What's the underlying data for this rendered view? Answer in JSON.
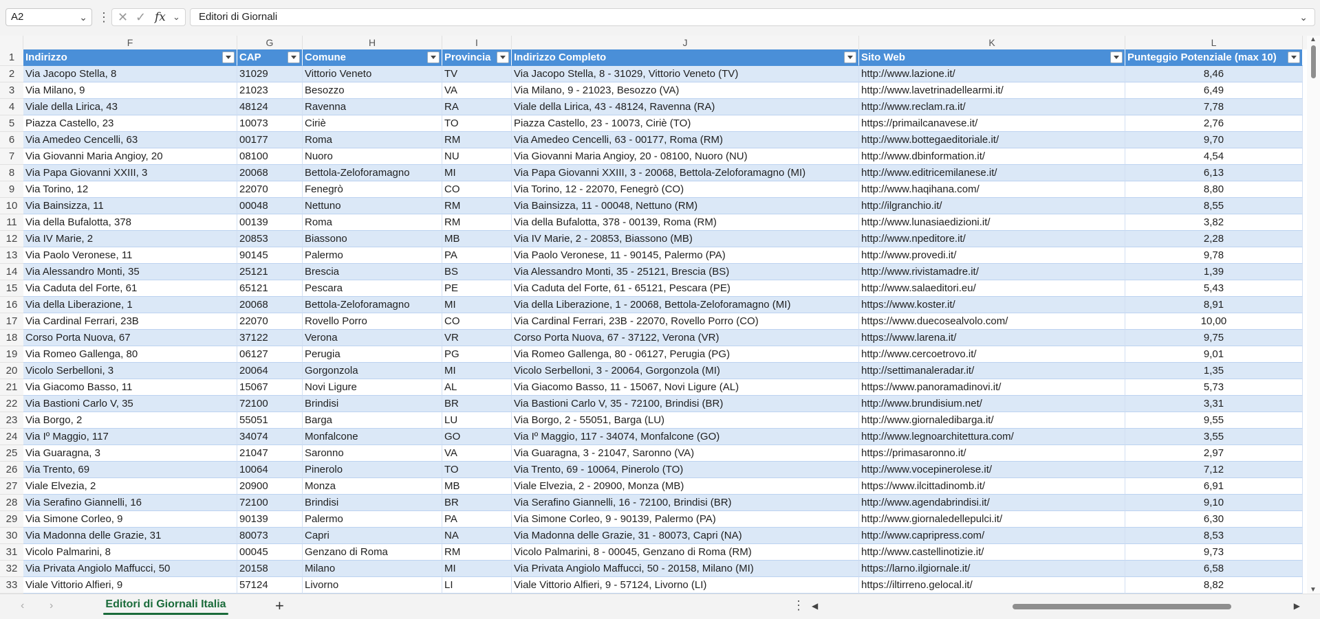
{
  "formula_bar": {
    "cell_ref": "A2",
    "formula_value": "Editori di Giornali",
    "fx_label": "fx",
    "cancel_icon": "close-icon",
    "enter_icon": "check-icon"
  },
  "columns": [
    "F",
    "G",
    "H",
    "I",
    "J",
    "K",
    "L"
  ],
  "table": {
    "headers": [
      "Indirizzo",
      "CAP",
      "Comune",
      "Provincia",
      "Indirizzo Completo",
      "Sito Web",
      "Punteggio Potenziale (max 10)"
    ],
    "rows": [
      [
        "2",
        "Via Jacopo Stella, 8",
        "31029",
        "Vittorio Veneto",
        "TV",
        "Via Jacopo Stella, 8 - 31029, Vittorio Veneto (TV)",
        "http://www.lazione.it/",
        "8,46"
      ],
      [
        "3",
        "Via Milano, 9",
        "21023",
        "Besozzo",
        "VA",
        "Via Milano, 9 - 21023, Besozzo (VA)",
        "http://www.lavetrinadellearmi.it/",
        "6,49"
      ],
      [
        "4",
        "Viale della Lirica, 43",
        "48124",
        "Ravenna",
        "RA",
        "Viale della Lirica, 43 - 48124, Ravenna (RA)",
        "http://www.reclam.ra.it/",
        "7,78"
      ],
      [
        "5",
        "Piazza Castello, 23",
        "10073",
        "Ciriè",
        "TO",
        "Piazza Castello, 23 - 10073, Ciriè (TO)",
        "https://primailcanavese.it/",
        "2,76"
      ],
      [
        "6",
        "Via Amedeo Cencelli, 63",
        "00177",
        "Roma",
        "RM",
        "Via Amedeo Cencelli, 63 - 00177, Roma (RM)",
        "http://www.bottegaeditoriale.it/",
        "9,70"
      ],
      [
        "7",
        "Via Giovanni Maria Angioy, 20",
        "08100",
        "Nuoro",
        "NU",
        "Via Giovanni Maria Angioy, 20 - 08100, Nuoro (NU)",
        "http://www.dbinformation.it/",
        "4,54"
      ],
      [
        "8",
        "Via Papa Giovanni XXIII, 3",
        "20068",
        "Bettola-Zeloforamagno",
        "MI",
        "Via Papa Giovanni XXIII, 3 - 20068, Bettola-Zeloforamagno (MI)",
        "http://www.editricemilanese.it/",
        "6,13"
      ],
      [
        "9",
        "Via Torino, 12",
        "22070",
        "Fenegrò",
        "CO",
        "Via Torino, 12 - 22070, Fenegrò (CO)",
        "http://www.haqihana.com/",
        "8,80"
      ],
      [
        "10",
        "Via Bainsizza, 11",
        "00048",
        "Nettuno",
        "RM",
        "Via Bainsizza, 11 - 00048, Nettuno (RM)",
        "http://ilgranchio.it/",
        "8,55"
      ],
      [
        "11",
        "Via della Bufalotta, 378",
        "00139",
        "Roma",
        "RM",
        "Via della Bufalotta, 378 - 00139, Roma (RM)",
        "http://www.lunasiaedizioni.it/",
        "3,82"
      ],
      [
        "12",
        "Via IV Marie, 2",
        "20853",
        "Biassono",
        "MB",
        "Via IV Marie, 2 - 20853, Biassono (MB)",
        "http://www.npeditore.it/",
        "2,28"
      ],
      [
        "13",
        "Via Paolo Veronese, 11",
        "90145",
        "Palermo",
        "PA",
        "Via Paolo Veronese, 11 - 90145, Palermo (PA)",
        "http://www.provedi.it/",
        "9,78"
      ],
      [
        "14",
        "Via Alessandro Monti, 35",
        "25121",
        "Brescia",
        "BS",
        "Via Alessandro Monti, 35 - 25121, Brescia (BS)",
        "http://www.rivistamadre.it/",
        "1,39"
      ],
      [
        "15",
        "Via Caduta del Forte, 61",
        "65121",
        "Pescara",
        "PE",
        "Via Caduta del Forte, 61 - 65121, Pescara (PE)",
        "http://www.salaeditori.eu/",
        "5,43"
      ],
      [
        "16",
        "Via della Liberazione, 1",
        "20068",
        "Bettola-Zeloforamagno",
        "MI",
        "Via della Liberazione, 1 - 20068, Bettola-Zeloforamagno (MI)",
        "https://www.koster.it/",
        "8,91"
      ],
      [
        "17",
        "Via Cardinal Ferrari, 23B",
        "22070",
        "Rovello Porro",
        "CO",
        "Via Cardinal Ferrari, 23B - 22070, Rovello Porro (CO)",
        "https://www.duecosealvolo.com/",
        "10,00"
      ],
      [
        "18",
        "Corso Porta Nuova, 67",
        "37122",
        "Verona",
        "VR",
        "Corso Porta Nuova, 67 - 37122, Verona (VR)",
        "https://www.larena.it/",
        "9,75"
      ],
      [
        "19",
        "Via Romeo Gallenga, 80",
        "06127",
        "Perugia",
        "PG",
        "Via Romeo Gallenga, 80 - 06127, Perugia (PG)",
        "http://www.cercoetrovo.it/",
        "9,01"
      ],
      [
        "20",
        "Vicolo Serbelloni, 3",
        "20064",
        "Gorgonzola",
        "MI",
        "Vicolo Serbelloni, 3 - 20064, Gorgonzola (MI)",
        "http://settimanaleradar.it/",
        "1,35"
      ],
      [
        "21",
        "Via Giacomo Basso, 11",
        "15067",
        "Novi Ligure",
        "AL",
        "Via Giacomo Basso, 11 - 15067, Novi Ligure (AL)",
        "https://www.panoramadinovi.it/",
        "5,73"
      ],
      [
        "22",
        "Via Bastioni Carlo V, 35",
        "72100",
        "Brindisi",
        "BR",
        "Via Bastioni Carlo V, 35 - 72100, Brindisi (BR)",
        "http://www.brundisium.net/",
        "3,31"
      ],
      [
        "23",
        "Via Borgo, 2",
        "55051",
        "Barga",
        "LU",
        "Via Borgo, 2 - 55051, Barga (LU)",
        "http://www.giornaledibarga.it/",
        "9,55"
      ],
      [
        "24",
        "Via Iº Maggio, 117",
        "34074",
        "Monfalcone",
        "GO",
        "Via Iº Maggio, 117 - 34074, Monfalcone (GO)",
        "http://www.legnoarchitettura.com/",
        "3,55"
      ],
      [
        "25",
        "Via Guaragna, 3",
        "21047",
        "Saronno",
        "VA",
        "Via Guaragna, 3 - 21047, Saronno (VA)",
        "https://primasaronno.it/",
        "2,97"
      ],
      [
        "26",
        "Via Trento, 69",
        "10064",
        "Pinerolo",
        "TO",
        "Via Trento, 69 - 10064, Pinerolo (TO)",
        "http://www.vocepinerolese.it/",
        "7,12"
      ],
      [
        "27",
        "Viale Elvezia, 2",
        "20900",
        "Monza",
        "MB",
        "Viale Elvezia, 2 - 20900, Monza (MB)",
        "https://www.ilcittadinomb.it/",
        "6,91"
      ],
      [
        "28",
        "Via Serafino Giannelli, 16",
        "72100",
        "Brindisi",
        "BR",
        "Via Serafino Giannelli, 16 - 72100, Brindisi (BR)",
        "http://www.agendabrindisi.it/",
        "9,10"
      ],
      [
        "29",
        "Via Simone Corleo, 9",
        "90139",
        "Palermo",
        "PA",
        "Via Simone Corleo, 9 - 90139, Palermo (PA)",
        "http://www.giornaledellepulci.it/",
        "6,30"
      ],
      [
        "30",
        "Via Madonna delle Grazie, 31",
        "80073",
        "Capri",
        "NA",
        "Via Madonna delle Grazie, 31 - 80073, Capri (NA)",
        "http://www.capripress.com/",
        "8,53"
      ],
      [
        "31",
        "Vicolo Palmarini, 8",
        "00045",
        "Genzano di Roma",
        "RM",
        "Vicolo Palmarini, 8 - 00045, Genzano di Roma (RM)",
        "http://www.castellinotizie.it/",
        "9,73"
      ],
      [
        "32",
        "Via Privata Angiolo Maffucci, 50",
        "20158",
        "Milano",
        "MI",
        "Via Privata Angiolo Maffucci, 50 - 20158, Milano (MI)",
        "https://larno.ilgiornale.it/",
        "6,58"
      ],
      [
        "33",
        "Viale Vittorio Alfieri, 9",
        "57124",
        "Livorno",
        "LI",
        "Viale Vittorio Alfieri, 9 - 57124, Livorno (LI)",
        "https://iltirreno.gelocal.it/",
        "8,82"
      ]
    ]
  },
  "sheet_tabs": {
    "active": "Editori di Giornali Italia",
    "add_label": "+"
  },
  "colors": {
    "header_bg": "#4a8fd8",
    "band_bg": "#dbe8f7",
    "active_tab": "#1a6b3a"
  }
}
